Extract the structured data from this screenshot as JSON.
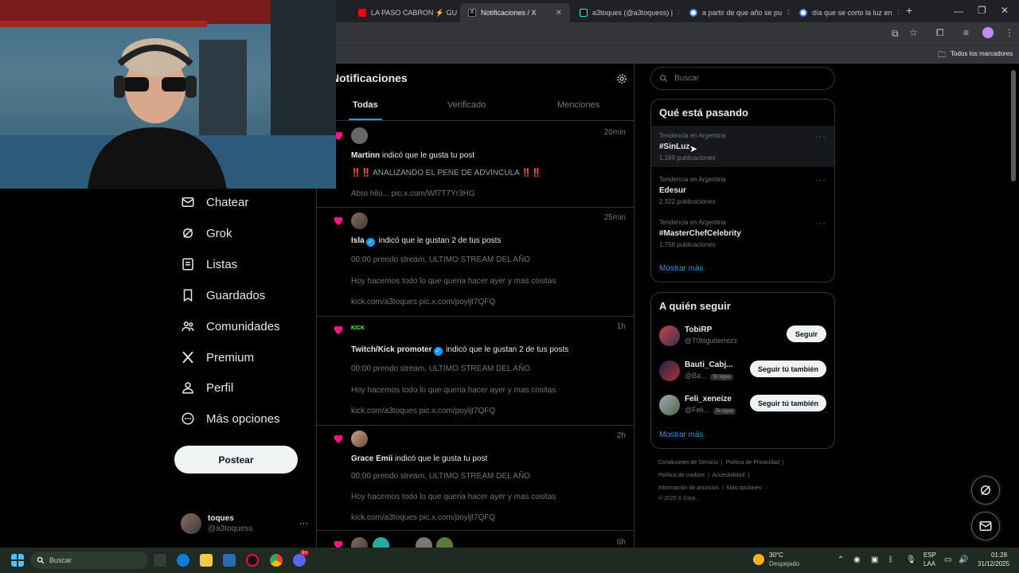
{
  "browser": {
    "tabs": [
      {
        "title": "LA PASO CABRON ⚡ GU",
        "color": "#ff0000"
      },
      {
        "title": "Notificaciones / X",
        "color": "#000000"
      },
      {
        "title": "a3toques (@a3toquess) |",
        "color": "#111111"
      },
      {
        "title": "a partir de que año se pu",
        "color": "#4285f4"
      },
      {
        "title": "día que se corto la luz en",
        "color": "#4285f4"
      }
    ],
    "new_tab": "+",
    "bookmarks_folder": "Todos los marcadores"
  },
  "nav": {
    "items": [
      {
        "label": "Chatear",
        "icon": "mail-icon"
      },
      {
        "label": "Grok",
        "icon": "grok-icon"
      },
      {
        "label": "Listas",
        "icon": "list-icon"
      },
      {
        "label": "Guardados",
        "icon": "bookmark-icon"
      },
      {
        "label": "Comunidades",
        "icon": "people-icon"
      },
      {
        "label": "Premium",
        "icon": "x-logo-icon"
      },
      {
        "label": "Perfil",
        "icon": "person-icon"
      },
      {
        "label": "Más opciones",
        "icon": "more-circle-icon"
      }
    ],
    "post_button": "Postear",
    "profile": {
      "name": "toques",
      "handle": "@a3toquess",
      "more": "···"
    }
  },
  "notifications": {
    "title": "Notificaciones",
    "tabs": [
      "Todas",
      "Verificado",
      "Menciones"
    ],
    "items": [
      {
        "time": "20min",
        "user": "Martinn",
        "action": " indicó que le gusta tu post",
        "lines": [
          "‼️‼️ ANALIZANDO EL PENE DE ADVINCULA ‼️‼️",
          "Abro hilo... pic.x.com/Wf7T7Yr3HG"
        ],
        "verified": false
      },
      {
        "time": "25min",
        "user": "Isla",
        "action": " indicó que le gustan 2 de tus posts",
        "lines": [
          "00:00 prendo stream, ULTIMO STREAM DEL AÑO",
          "Hoy hacemos todo lo que queria hacer ayer y mas cositas",
          "kick.com/a3toques pic.x.com/poyljt7QFQ"
        ],
        "verified": true
      },
      {
        "time": "1h",
        "user": "Twitch/Kick promoter",
        "action": " indicó que le gustan 2 de tus posts",
        "lines": [
          "00:00 prendo stream, ULTIMO STREAM DEL AÑO",
          "Hoy hacemos todo lo que queria hacer ayer y mas cositas",
          "kick.com/a3toques pic.x.com/poyljt7QFQ"
        ],
        "verified": true,
        "badge": "KICK"
      },
      {
        "time": "2h",
        "user": "Grace Emii",
        "action": " indicó que le gusta tu post",
        "lines": [
          "00:00 prendo stream, ULTIMO STREAM DEL AÑO",
          "Hoy hacemos todo lo que queria hacer ayer y mas cositas",
          "kick.com/a3toques pic.x.com/poyljt7QFQ"
        ],
        "verified": false
      },
      {
        "time": "6h"
      }
    ]
  },
  "search": {
    "placeholder": "Buscar"
  },
  "trends": {
    "title": "Qué está pasando",
    "items": [
      {
        "category": "Tendencia en Argentina",
        "name": "#SinLuz",
        "count": "1.169 publicaciones"
      },
      {
        "category": "Tendencia en Argentina",
        "name": "Edesur",
        "count": "2.322 publicaciones"
      },
      {
        "category": "Tendencia en Argentina",
        "name": "#MasterChefCelebrity",
        "count": "1.756 publicaciones"
      }
    ],
    "show_more": "Mostrar más",
    "more": "···"
  },
  "who_to_follow": {
    "title": "A quién seguir",
    "items": [
      {
        "name": "TobiRP",
        "handle": "@T0bigutierrezz",
        "button": "Seguir",
        "badge": ""
      },
      {
        "name": "Bauti_Cabj...",
        "handle": "@Ba...",
        "button": "Seguir tú también",
        "badge": "Te sigue"
      },
      {
        "name": "Feli_xeneize",
        "handle": "@Feli...",
        "button": "Seguir tú también",
        "badge": "Te sigue"
      }
    ],
    "show_more": "Mostrar más"
  },
  "footer": {
    "line1": [
      "Condiciones de Servicio",
      "Política de Privacidad"
    ],
    "line2": [
      "Política de cookies",
      "Accesibilidad"
    ],
    "line3": [
      "Información de anuncios",
      "Más opciones ···"
    ],
    "copyright": "© 2025 X Corp."
  },
  "taskbar": {
    "search": "Buscar",
    "weather_temp": "30°C",
    "weather_desc": "Despejado",
    "lang": "ESP",
    "lang2": "LAA",
    "time": "01:28",
    "date": "31/12/2025",
    "discord_badge": "9+"
  },
  "colors": {
    "accent": "#1d9bf0",
    "heart": "#f91880",
    "kick": "#53fc18"
  }
}
